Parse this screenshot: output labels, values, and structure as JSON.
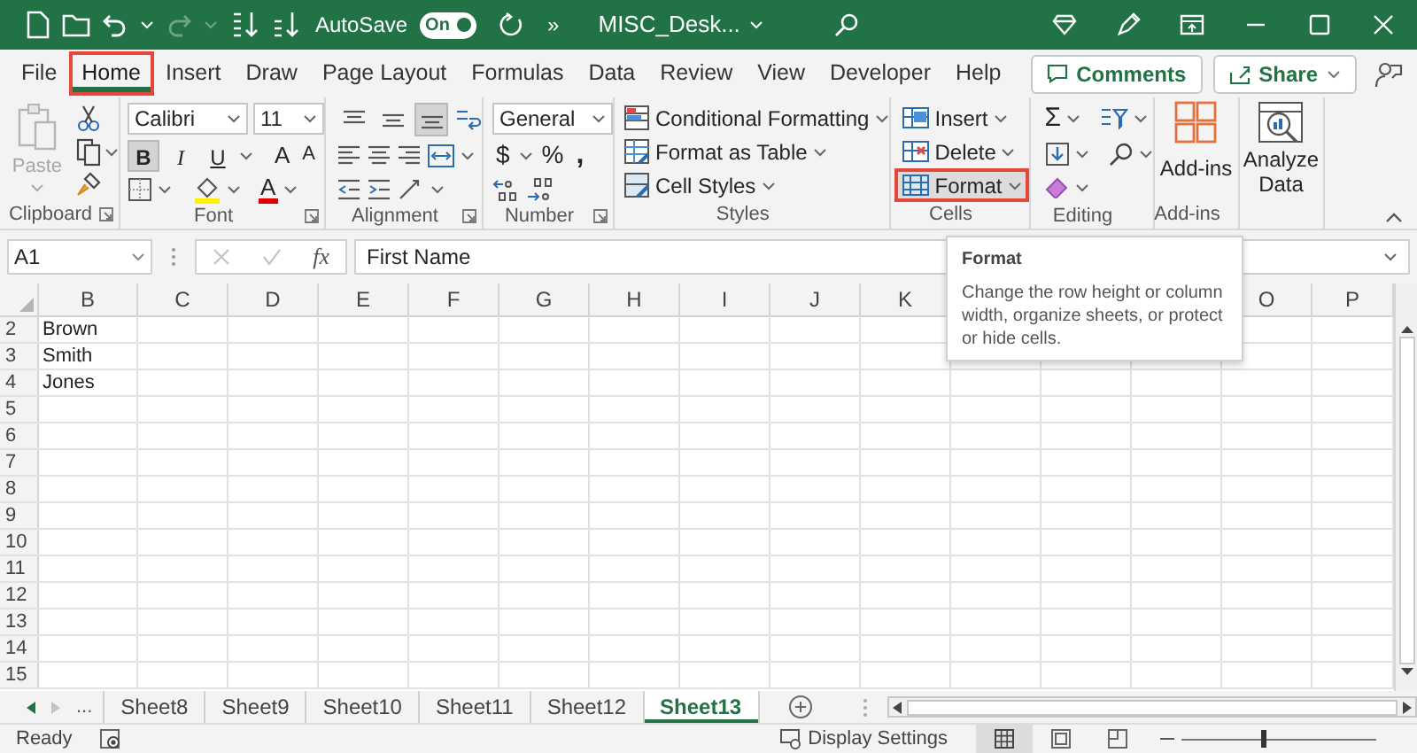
{
  "title_bar": {
    "autosave_label": "AutoSave",
    "autosave": {
      "label": "On",
      "on": true
    },
    "more": "»",
    "file_name": "MISC_Desk..."
  },
  "tabs": [
    {
      "label": "File",
      "selected": false,
      "highlighted": false
    },
    {
      "label": "Home",
      "selected": true,
      "highlighted": true
    },
    {
      "label": "Insert",
      "selected": false,
      "highlighted": false
    },
    {
      "label": "Draw",
      "selected": false,
      "highlighted": false
    },
    {
      "label": "Page Layout",
      "selected": false,
      "highlighted": false
    },
    {
      "label": "Formulas",
      "selected": false,
      "highlighted": false
    },
    {
      "label": "Data",
      "selected": false,
      "highlighted": false
    },
    {
      "label": "Review",
      "selected": false,
      "highlighted": false
    },
    {
      "label": "View",
      "selected": false,
      "highlighted": false
    },
    {
      "label": "Developer",
      "selected": false,
      "highlighted": false
    },
    {
      "label": "Help",
      "selected": false,
      "highlighted": false
    }
  ],
  "actions": [
    {
      "label": "Comments"
    },
    {
      "label": "Share"
    }
  ],
  "ribbon": {
    "clipboard": {
      "paste": {
        "label": "Paste",
        "disabled": true
      },
      "group": "Clipboard"
    },
    "font": {
      "name": "Calibri",
      "size": "11",
      "styles": [
        {
          "label": "B",
          "selected": true
        },
        {
          "label": "I",
          "selected": false
        },
        {
          "label": "U",
          "selected": false
        }
      ],
      "grow": "A",
      "shrink": "A",
      "font_color_glyph": "A",
      "group": "Font"
    },
    "alignment": {
      "vertical": [
        {
          "selected": false
        },
        {
          "selected": false
        },
        {
          "selected": true
        }
      ],
      "group": "Alignment"
    },
    "number": {
      "format": "General",
      "currency": "$",
      "percent": "%",
      "comma": ",",
      "group": "Number"
    },
    "styles": {
      "items": [
        "Conditional Formatting",
        "Format as Table",
        "Cell Styles"
      ],
      "group": "Styles"
    },
    "cells": {
      "items": [
        {
          "label": "Insert",
          "highlighted": false
        },
        {
          "label": "Delete",
          "highlighted": false
        },
        {
          "label": "Format",
          "highlighted": true
        }
      ],
      "group": "Cells"
    },
    "editing": {
      "sum": "Σ",
      "group": "Editing"
    },
    "addins": {
      "label": "Add-ins",
      "group": "Add-ins"
    },
    "analyze": {
      "label": "Analyze Data"
    }
  },
  "formula_bar": {
    "name_box": "A1",
    "fx": "fx",
    "formula": "First Name"
  },
  "tooltip": {
    "title": "Format",
    "text": "Change the row height or column width, organize sheets, or protect or hide cells."
  },
  "sheet": {
    "columns": [
      "B",
      "C",
      "D",
      "E",
      "F",
      "G",
      "H",
      "I",
      "J",
      "K",
      null,
      null,
      null,
      "O",
      "P"
    ],
    "rows": [
      {
        "number": "2",
        "value": "Brown"
      },
      {
        "number": "3",
        "value": "Smith"
      },
      {
        "number": "4",
        "value": "Jones"
      },
      {
        "number": "5"
      },
      {
        "number": "6"
      },
      {
        "number": "7"
      },
      {
        "number": "8"
      },
      {
        "number": "9"
      },
      {
        "number": "10"
      },
      {
        "number": "11"
      },
      {
        "number": "12"
      },
      {
        "number": "13"
      },
      {
        "number": "14"
      },
      {
        "number": "15"
      }
    ]
  },
  "sheet_tabs": {
    "more": "...",
    "tabs": [
      {
        "label": "Sheet8",
        "selected": false
      },
      {
        "label": "Sheet9",
        "selected": false
      },
      {
        "label": "Sheet10",
        "selected": false
      },
      {
        "label": "Sheet11",
        "selected": false
      },
      {
        "label": "Sheet12",
        "selected": false
      },
      {
        "label": "Sheet13",
        "selected": true
      }
    ]
  },
  "status_bar": {
    "status": "Ready",
    "display_settings": "Display Settings",
    "views": [
      {
        "selected": true
      },
      {
        "selected": false
      },
      {
        "selected": false
      }
    ],
    "zoom": {
      "level": 0.42
    }
  }
}
